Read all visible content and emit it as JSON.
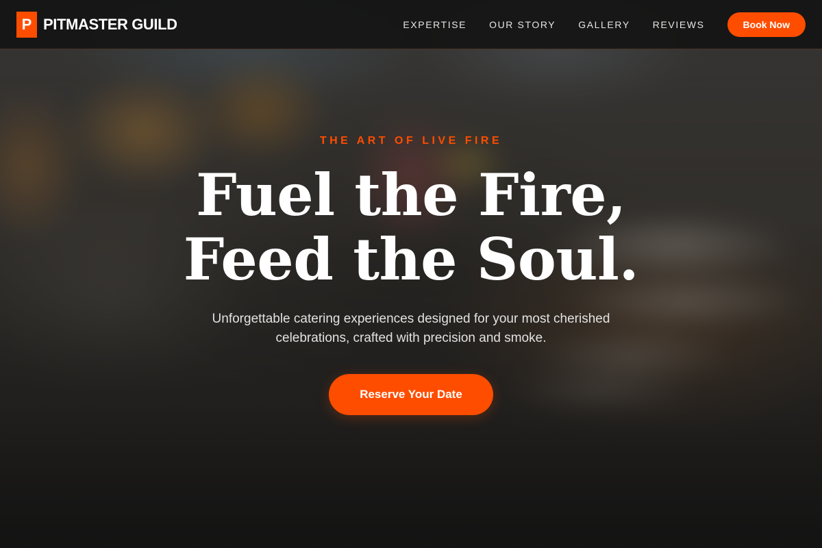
{
  "brand": {
    "badge_letter": "P",
    "name": "PITMASTER GUILD"
  },
  "nav": {
    "links": [
      {
        "label": "EXPERTISE"
      },
      {
        "label": "OUR STORY"
      },
      {
        "label": "GALLERY"
      },
      {
        "label": "REVIEWS"
      }
    ],
    "book_label": "Book Now"
  },
  "hero": {
    "eyebrow": "THE ART OF LIVE FIRE",
    "headline_line1": "Fuel the Fire,",
    "headline_line2": "Feed the Soul.",
    "subtext": "Unforgettable catering experiences designed for your most cherished celebrations, crafted with precision and smoke.",
    "cta_label": "Reserve Your Date",
    "background_image": "blurred-banquet-table-photo"
  },
  "colors": {
    "accent": "#ff4d00",
    "navbar_bg": "#141414",
    "text_primary": "#ffffff",
    "text_secondary": "#e2e2e2"
  }
}
